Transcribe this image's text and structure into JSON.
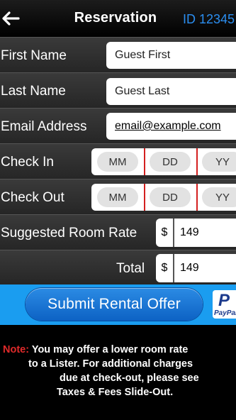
{
  "header": {
    "title": "Reservation",
    "id_label": "ID 12345",
    "back_icon": "arrow-left-icon"
  },
  "form": {
    "first_name": {
      "label": "First Name",
      "value": "Guest First"
    },
    "last_name": {
      "label": "Last Name",
      "value": "Guest Last"
    },
    "email": {
      "label": "Email Address",
      "value": "email@example.com"
    },
    "check_in": {
      "label": "Check In",
      "mm": "MM",
      "dd": "DD",
      "yy": "YY"
    },
    "check_out": {
      "label": "Check Out",
      "mm": "MM",
      "dd": "DD",
      "yy": "YY"
    },
    "room_rate": {
      "label": "Suggested Room Rate",
      "currency": "$",
      "value": "149"
    },
    "total": {
      "label": "Total",
      "currency": "$",
      "value": "149"
    }
  },
  "submit": {
    "label": "Submit Rental Offer"
  },
  "paypal": {
    "mark": "P",
    "text": "PayPal"
  },
  "note": {
    "label": "Note:",
    "line1": "You may offer a lower room rate",
    "line2": "to a Lister. For additional charges",
    "line3": "due at check-out, please see",
    "line4": "Taxes & Fees Slide-Out."
  },
  "colors": {
    "accent": "#1a9df0",
    "id_text": "#2b8ef0",
    "divider": "#d42020",
    "note_label": "#e02a2a"
  }
}
